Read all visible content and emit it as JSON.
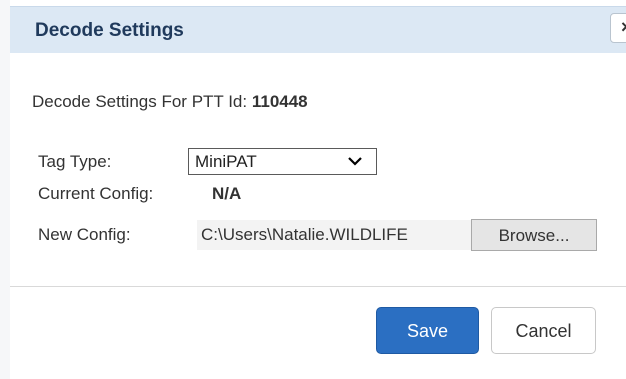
{
  "dialog": {
    "title": "Decode Settings",
    "close_label": "×"
  },
  "form": {
    "heading_prefix": "Decode Settings For PTT Id: ",
    "ptt_id": "110448",
    "tag_type_label": "Tag Type:",
    "tag_type_value": "MiniPAT",
    "current_config_label": "Current Config:",
    "current_config_value": "N/A",
    "new_config_label": "New Config:",
    "new_config_value": "C:\\Users\\Natalie.WILDLIFE",
    "browse_label": "Browse..."
  },
  "footer": {
    "save_label": "Save",
    "cancel_label": "Cancel"
  },
  "icons": {
    "close": "close-icon",
    "dropdown": "chevron-down-icon"
  },
  "colors": {
    "titlebar_bg": "#dce8f4",
    "title_text": "#203a5c",
    "primary_button": "#2b6fc2"
  }
}
